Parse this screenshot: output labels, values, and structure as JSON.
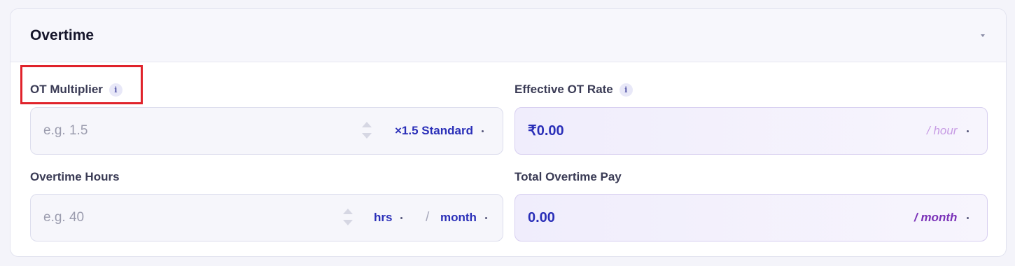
{
  "section": {
    "title": "Overtime"
  },
  "fields": {
    "ot_multiplier": {
      "label": "OT Multiplier",
      "placeholder": "e.g. 1.5",
      "preset": "×1.5 Standard"
    },
    "effective_ot_rate": {
      "label": "Effective OT Rate",
      "value": "₹0.00",
      "unit": "/ hour"
    },
    "overtime_hours": {
      "label": "Overtime Hours",
      "placeholder": "e.g. 40",
      "unit": "hrs",
      "separator": "/",
      "period": "month"
    },
    "total_overtime_pay": {
      "label": "Total Overtime Pay",
      "value": "0.00",
      "unit": "/ month"
    }
  },
  "colors": {
    "accent": "#2a2fb8",
    "purple_unit": "#7a31b8",
    "light_purple_unit": "#c79be4",
    "highlight": "#e0232b"
  },
  "icons": {
    "info": "info-icon",
    "spinner": "number-spinner-icon",
    "dropdown": "chevron-down-icon"
  }
}
